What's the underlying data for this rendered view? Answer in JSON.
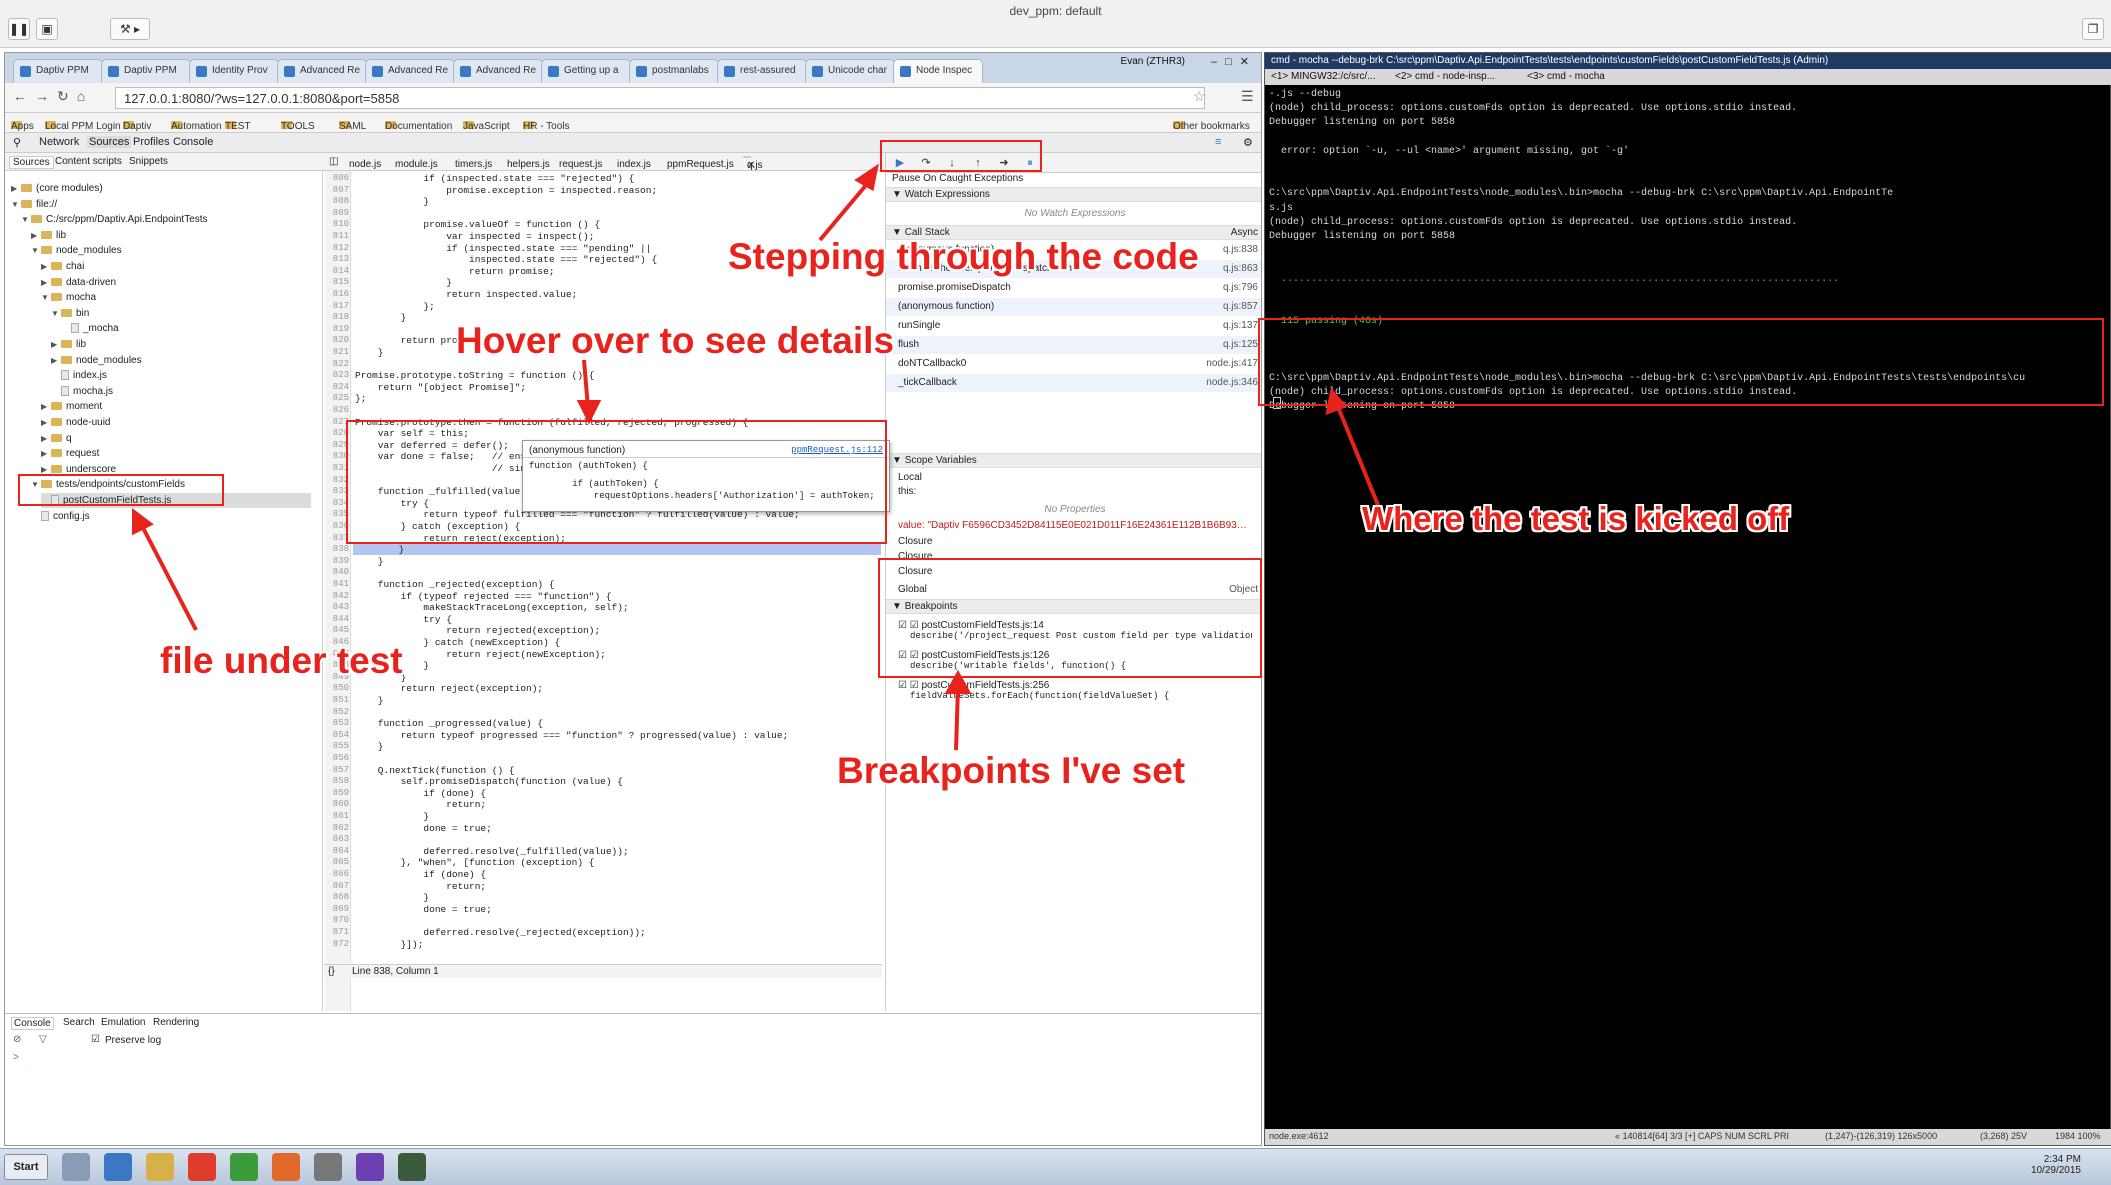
{
  "window_title": "dev_ppm: default",
  "browser": {
    "tabs": [
      "Daptiv PPM",
      "Daptiv PPM",
      "Identity Prov",
      "Advanced Re",
      "Advanced Re",
      "Advanced Re",
      "Getting up a",
      "postmanlabs",
      "rest-assured",
      "Unicode char",
      "Node Inspec"
    ],
    "user": "Evan (ZTHR3)",
    "url": "127.0.0.1:8080/?ws=127.0.0.1:8080&port=5858",
    "bookmarks": [
      "Apps",
      "Local PPM Login",
      "Daptiv",
      "Automation",
      "TEST",
      "TOOLS",
      "SAML",
      "Documentation",
      "JavaScript",
      "HR - Tools",
      "Other bookmarks"
    ]
  },
  "devtools": {
    "panels": [
      "Network",
      "Sources",
      "Profiles",
      "Console"
    ],
    "nav_tabs": [
      "Sources",
      "Content scripts",
      "Snippets"
    ],
    "tree": [
      {
        "label": "(core modules)",
        "indent": 0,
        "type": "folder",
        "open": false
      },
      {
        "label": "file://",
        "indent": 0,
        "type": "folder",
        "open": true
      },
      {
        "label": "C:/src/ppm/Daptiv.Api.EndpointTests",
        "indent": 1,
        "type": "folder",
        "open": true
      },
      {
        "label": "lib",
        "indent": 2,
        "type": "folder",
        "open": false
      },
      {
        "label": "node_modules",
        "indent": 2,
        "type": "folder",
        "open": true
      },
      {
        "label": "chai",
        "indent": 3,
        "type": "folder",
        "open": false
      },
      {
        "label": "data-driven",
        "indent": 3,
        "type": "folder",
        "open": false
      },
      {
        "label": "mocha",
        "indent": 3,
        "type": "folder",
        "open": true
      },
      {
        "label": "bin",
        "indent": 4,
        "type": "folder",
        "open": true
      },
      {
        "label": "_mocha",
        "indent": 5,
        "type": "file"
      },
      {
        "label": "lib",
        "indent": 4,
        "type": "folder",
        "open": false
      },
      {
        "label": "node_modules",
        "indent": 4,
        "type": "folder",
        "open": false
      },
      {
        "label": "index.js",
        "indent": 4,
        "type": "file"
      },
      {
        "label": "mocha.js",
        "indent": 4,
        "type": "file"
      },
      {
        "label": "moment",
        "indent": 3,
        "type": "folder",
        "open": false
      },
      {
        "label": "node-uuid",
        "indent": 3,
        "type": "folder",
        "open": false
      },
      {
        "label": "q",
        "indent": 3,
        "type": "folder",
        "open": false
      },
      {
        "label": "request",
        "indent": 3,
        "type": "folder",
        "open": false
      },
      {
        "label": "underscore",
        "indent": 3,
        "type": "folder",
        "open": false
      },
      {
        "label": "tests/endpoints/customFields",
        "indent": 2,
        "type": "folder",
        "open": true
      },
      {
        "label": "postCustomFieldTests.js",
        "indent": 3,
        "type": "file",
        "selected": true
      },
      {
        "label": "config.js",
        "indent": 2,
        "type": "file"
      }
    ],
    "editor_tabs": [
      "node.js",
      "module.js",
      "timers.js",
      "helpers.js",
      "request.js",
      "index.js",
      "ppmRequest.js",
      "q.js"
    ],
    "code": [
      {
        "n": "806",
        "t": "            if (inspected.state === \"rejected\") {"
      },
      {
        "n": "807",
        "t": "                promise.exception = inspected.reason;"
      },
      {
        "n": "808",
        "t": "            }"
      },
      {
        "n": "809",
        "t": ""
      },
      {
        "n": "810",
        "t": "            promise.valueOf = function () {"
      },
      {
        "n": "811",
        "t": "                var inspected = inspect();"
      },
      {
        "n": "812",
        "t": "                if (inspected.state === \"pending\" ||"
      },
      {
        "n": "813",
        "t": "                    inspected.state === \"rejected\") {"
      },
      {
        "n": "814",
        "t": "                    return promise;"
      },
      {
        "n": "815",
        "t": "                }"
      },
      {
        "n": "816",
        "t": "                return inspected.value;"
      },
      {
        "n": "817",
        "t": "            };"
      },
      {
        "n": "818",
        "t": "        }"
      },
      {
        "n": "819",
        "t": ""
      },
      {
        "n": "820",
        "t": "        return promise;"
      },
      {
        "n": "821",
        "t": "    }"
      },
      {
        "n": "822",
        "t": ""
      },
      {
        "n": "823",
        "t": "Promise.prototype.toString = function () {"
      },
      {
        "n": "824",
        "t": "    return \"[object Promise]\";"
      },
      {
        "n": "825",
        "t": "};"
      },
      {
        "n": "826",
        "t": ""
      },
      {
        "n": "827",
        "t": "Promise.prototype.then = function (fulfilled, rejected, progressed) {"
      },
      {
        "n": "828",
        "t": "    var self = this;"
      },
      {
        "n": "829",
        "t": "    var deferred = defer();"
      },
      {
        "n": "830",
        "t": "    var done = false;   // ensu"
      },
      {
        "n": "831",
        "t": "                        // sing"
      },
      {
        "n": "832",
        "t": ""
      },
      {
        "n": "833",
        "t": "    function _fulfilled(value)"
      },
      {
        "n": "834",
        "t": "        try {"
      },
      {
        "n": "835",
        "t": "            return typeof fulfilled === \"function\" ? fulfilled(value) : value;"
      },
      {
        "n": "836",
        "t": "        } catch (exception) {"
      },
      {
        "n": "837",
        "t": "            return reject(exception);"
      },
      {
        "n": "838",
        "t": "        }"
      },
      {
        "n": "839",
        "t": "    }"
      },
      {
        "n": "840",
        "t": ""
      },
      {
        "n": "841",
        "t": "    function _rejected(exception) {"
      },
      {
        "n": "842",
        "t": "        if (typeof rejected === \"function\") {"
      },
      {
        "n": "843",
        "t": "            makeStackTraceLong(exception, self);"
      },
      {
        "n": "844",
        "t": "            try {"
      },
      {
        "n": "845",
        "t": "                return rejected(exception);"
      },
      {
        "n": "846",
        "t": "            } catch (newException) {"
      },
      {
        "n": "847",
        "t": "                return reject(newException);"
      },
      {
        "n": "848",
        "t": "            }"
      },
      {
        "n": "849",
        "t": "        }"
      },
      {
        "n": "850",
        "t": "        return reject(exception);"
      },
      {
        "n": "851",
        "t": "    }"
      },
      {
        "n": "852",
        "t": ""
      },
      {
        "n": "853",
        "t": "    function _progressed(value) {"
      },
      {
        "n": "854",
        "t": "        return typeof progressed === \"function\" ? progressed(value) : value;"
      },
      {
        "n": "855",
        "t": "    }"
      },
      {
        "n": "856",
        "t": ""
      },
      {
        "n": "857",
        "t": "    Q.nextTick(function () {"
      },
      {
        "n": "858",
        "t": "        self.promiseDispatch(function (value) {"
      },
      {
        "n": "859",
        "t": "            if (done) {"
      },
      {
        "n": "860",
        "t": "                return;"
      },
      {
        "n": "861",
        "t": "            }"
      },
      {
        "n": "862",
        "t": "            done = true;"
      },
      {
        "n": "863",
        "t": ""
      },
      {
        "n": "864",
        "t": "            deferred.resolve(_fulfilled(value));"
      },
      {
        "n": "865",
        "t": "        }, \"when\", [function (exception) {"
      },
      {
        "n": "866",
        "t": "            if (done) {"
      },
      {
        "n": "867",
        "t": "                return;"
      },
      {
        "n": "868",
        "t": "            }"
      },
      {
        "n": "869",
        "t": "            done = true;"
      },
      {
        "n": "870",
        "t": ""
      },
      {
        "n": "871",
        "t": "            deferred.resolve(_rejected(exception));"
      },
      {
        "n": "872",
        "t": "        }]);"
      }
    ],
    "status_bar": "Line 838, Column 1",
    "tooltip": {
      "title": "(anonymous function)",
      "link": "ppmRequest.js:112",
      "line1": "function (authToken) {",
      "line2": "        if (authToken) {",
      "line3": "            requestOptions.headers['Authorization'] = authToken;"
    },
    "sidebar": {
      "pause_label": "Pause On Caught Exceptions",
      "watch": "Watch Expressions",
      "watch_empty": "No Watch Expressions",
      "call_stack": "Call Stack",
      "async": "Async",
      "frames": [
        {
          "name": "(anonymous function)",
          "loc": "q.js:838"
        },
        {
          "name": "Promise.then.self.promiseDispatch.done",
          "loc": "q.js:863"
        },
        {
          "name": "promise.promiseDispatch",
          "loc": "q.js:796"
        },
        {
          "name": "(anonymous function)",
          "loc": "q.js:857"
        },
        {
          "name": "runSingle",
          "loc": "q.js:137"
        },
        {
          "name": "flush",
          "loc": "q.js:125"
        },
        {
          "name": "doNTCallback0",
          "loc": "node.js:417"
        },
        {
          "name": "_tickCallback",
          "loc": "node.js:346"
        }
      ],
      "scope": "Scope Variables",
      "local": "Local",
      "this": "this:",
      "no_props": "No Properties",
      "value": "value: \"Daptiv F6596CD3452D84115E0E021D011F16E24361E112B1B6B93…",
      "closures": [
        "Closure",
        "Closure",
        "Closure"
      ],
      "global": "Global",
      "global_val": "Object",
      "breakpoints": "Breakpoints",
      "bps": [
        {
          "file": "postCustomFieldTests.js:14",
          "code": "describe('/project_request Post custom field per type validation',"
        },
        {
          "file": "postCustomFieldTests.js:126",
          "code": "describe('writable fields', function() {"
        },
        {
          "file": "postCustomFieldTests.js:256",
          "code": "fieldValueSets.forEach(function(fieldValueSet) {"
        }
      ]
    },
    "console_tabs": [
      "Console",
      "Search",
      "Emulation",
      "Rendering"
    ],
    "preserve_log": "Preserve log",
    "prompt": ">"
  },
  "terminal": {
    "title": "cmd - mocha  --debug-brk C:\\src\\ppm\\Daptiv.Api.EndpointTests\\tests\\endpoints\\customFields\\postCustomFieldTests.js (Admin)",
    "tabs": [
      "<1> MINGW32:/c/src/...",
      "<2> cmd - node-insp...",
      "<3> cmd - mocha"
    ],
    "lines": [
      "-.js --debug",
      "(node) child_process: options.customFds option is deprecated. Use options.stdio instead.",
      "Debugger listening on port 5858",
      "",
      "  error: option `-u, --ul <name>' argument missing, got `-g'",
      "",
      "",
      "C:\\src\\ppm\\Daptiv.Api.EndpointTests\\node_modules\\.bin>mocha --debug-brk C:\\src\\ppm\\Daptiv.Api.EndpointTe",
      "s.js",
      "(node) child_process: options.customFds option is deprecated. Use options.stdio instead.",
      "Debugger listening on port 5858",
      "",
      "",
      "  .............................................................................................",
      "",
      "",
      "  115 passing (46s)",
      "",
      "",
      "",
      "C:\\src\\ppm\\Daptiv.Api.EndpointTests\\node_modules\\.bin>mocha --debug-brk C:\\src\\ppm\\Daptiv.Api.EndpointTests\\tests\\endpoints\\cu",
      "(node) child_process: options.customFds option is deprecated. Use options.stdio instead.",
      "Debugger listening on port 5858"
    ],
    "status": [
      "node.exe:4612",
      "« 140814[64]  3/3  [+]  CAPS  NUM  SCRL  PRI",
      "(1,247)-(126,319)  126x5000",
      "(3,268) 25V",
      "1984  100%"
    ]
  },
  "annotations": {
    "stepping": "Stepping through the code",
    "hover": "Hover over to see details",
    "file": "file under test",
    "breakpoints": "Breakpoints I've set",
    "kicked": "Where the test is kicked off"
  },
  "taskbar": {
    "start": "Start",
    "time": "2:34 PM",
    "date": "10/29/2015"
  },
  "colors": {
    "annotation": "#e8221c",
    "terminal_bg": "#000000",
    "highlight": "#b3c6f2"
  }
}
